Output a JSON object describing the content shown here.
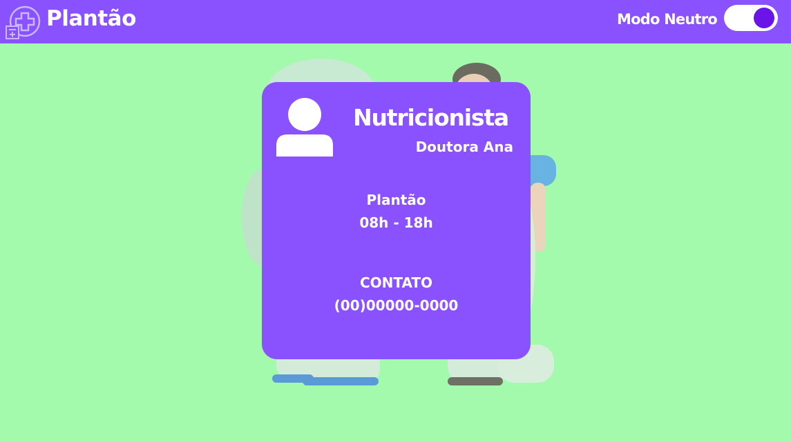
{
  "header": {
    "brand": "Plantão",
    "mode_label": "Modo Neutro",
    "mode_toggle_on": true,
    "logo_icon": "hospital-plus-icon"
  },
  "card": {
    "avatar_icon": "user-icon",
    "role": "Nutricionista",
    "doctor_name": "Doutora Ana",
    "shift_label": "Plantão",
    "shift_hours": "08h - 18h",
    "contact_label": "CONTATO",
    "contact_phone": "(00)00000-0000"
  },
  "colors": {
    "background": "#a3f9ac",
    "accent": "#8a52fe",
    "toggle_knob": "#6a14e8"
  }
}
